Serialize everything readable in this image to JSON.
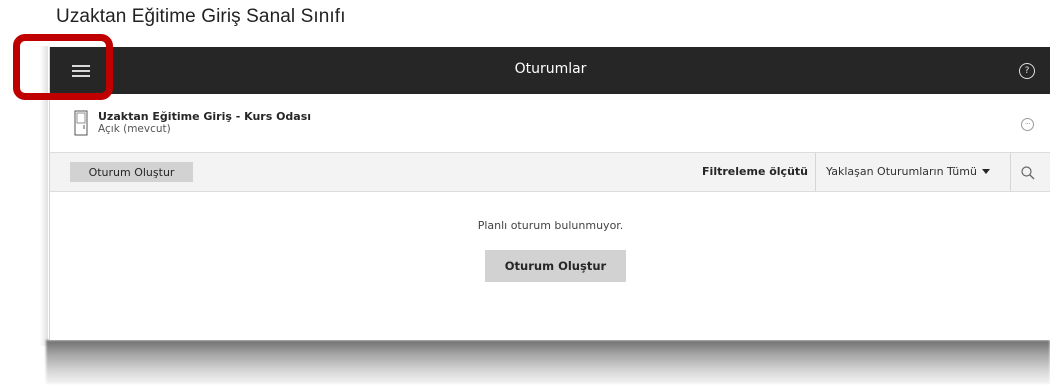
{
  "page": {
    "title": "Uzaktan Eğitime Giriş Sanal Sınıfı"
  },
  "header": {
    "title": "Oturumlar",
    "menu_icon": "hamburger-menu-icon",
    "help_icon": "help-circle-icon",
    "help_glyph": "?"
  },
  "room": {
    "name": "Uzaktan Eğitime Giriş - Kurs Odası",
    "status": "Açık (mevcut)",
    "icon": "room-door-icon",
    "more_icon": "more-options-icon",
    "more_glyph": "···"
  },
  "toolbar": {
    "create_label": "Oturum Oluştur",
    "filter_label": "Filtreleme ölçütü",
    "filter_value": "Yaklaşan Oturumların Tümü",
    "search_icon": "search-icon"
  },
  "empty_state": {
    "message": "Planlı oturum bulunmuyor.",
    "create_label": "Oturum Oluştur"
  },
  "colors": {
    "header_bg": "#262626",
    "highlight": "#c00000",
    "button_bg": "#d2d2d2",
    "toolbar_bg": "#f3f3f3"
  }
}
